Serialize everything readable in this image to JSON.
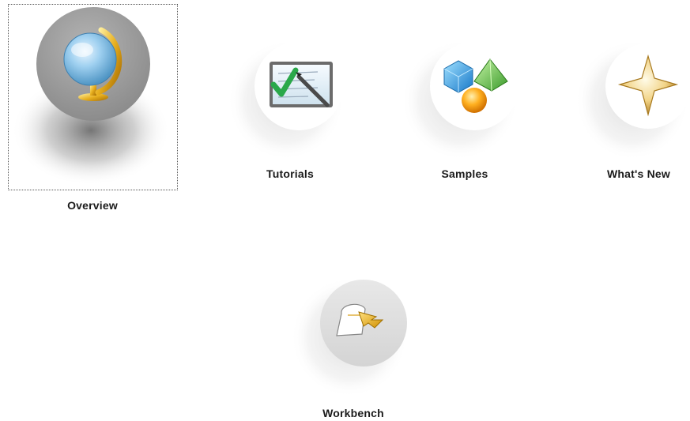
{
  "items": [
    {
      "label": "Overview",
      "icon": "globe-icon",
      "selected": true
    },
    {
      "label": "Tutorials",
      "icon": "checklist-icon",
      "selected": false
    },
    {
      "label": "Samples",
      "icon": "shapes-icon",
      "selected": false
    },
    {
      "label": "What's New",
      "icon": "star-icon",
      "selected": false
    },
    {
      "label": "Workbench",
      "icon": "workbench-arrow-icon",
      "selected": false
    }
  ],
  "colors": {
    "selected_circle": "#9a9a9a",
    "unselected_circle": "#ffffff",
    "workbench_circle": "#e2e2e2",
    "label_text": "#1a1a1a"
  }
}
